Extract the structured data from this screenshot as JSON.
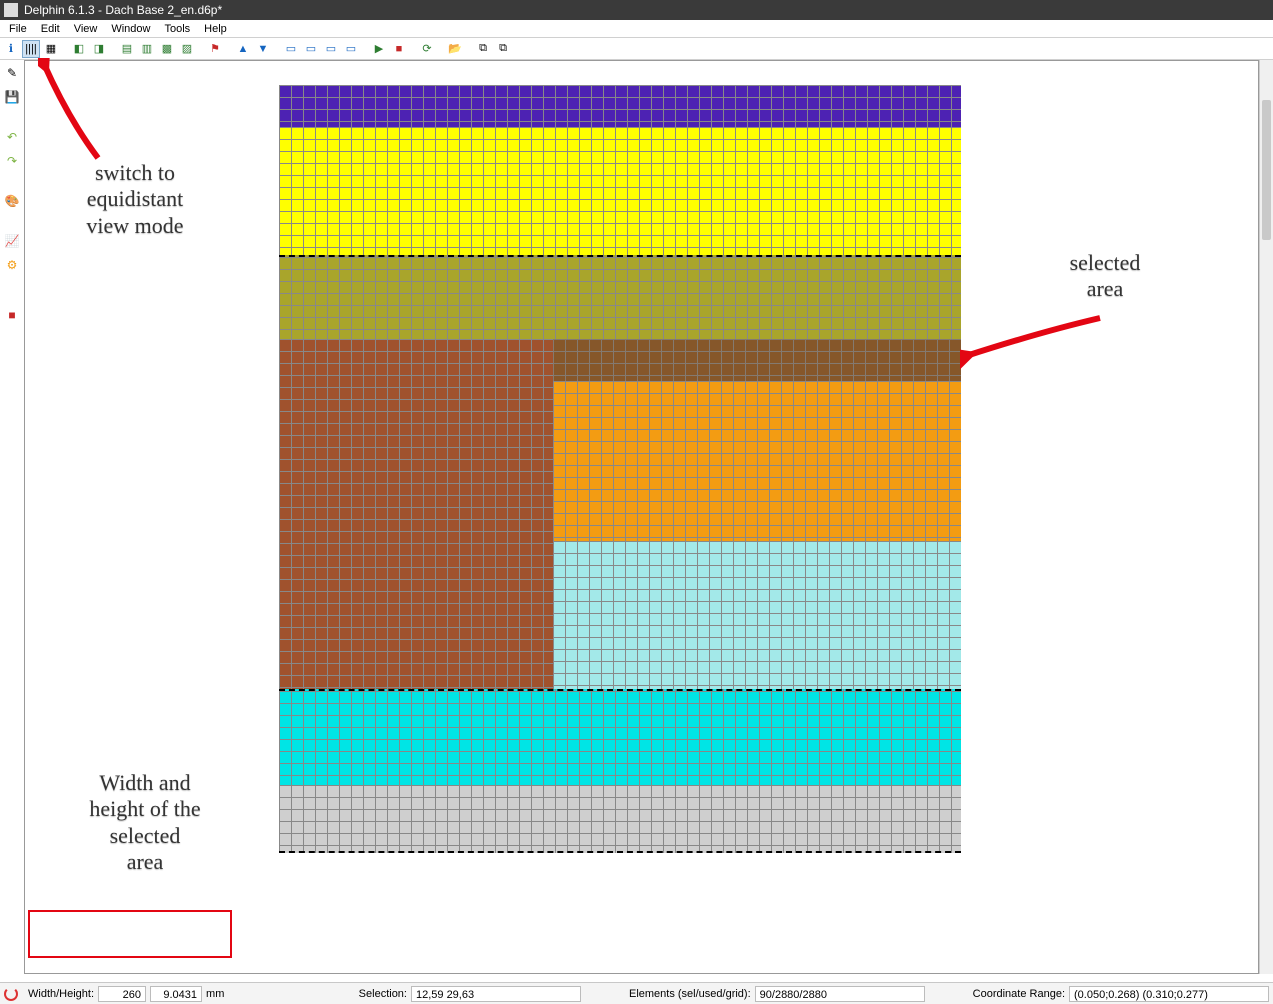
{
  "titlebar": {
    "text": "Delphin 6.1.3 - Dach Base 2_en.d6p*"
  },
  "menu": {
    "file": "File",
    "edit": "Edit",
    "view": "View",
    "window": "Window",
    "tools": "Tools",
    "help": "Help"
  },
  "toolbar": {
    "info": "ℹ",
    "grid": "▦",
    "equi": "||||",
    "proportional": "▦",
    "fliph": "⇋",
    "n1": "◧",
    "n2": "◨",
    "g1": "▤",
    "g2": "▥",
    "g3": "▩",
    "g4": "▨",
    "flag": "⚑",
    "flip": "▲",
    "flip2": "▼",
    "s1": "▭",
    "s2": "▭",
    "s3": "▭",
    "s4": "▭",
    "run": "▶",
    "stop": "■",
    "ref": "⟳",
    "open": "📂",
    "copy": "⧉",
    "paste": "⧉"
  },
  "vtool": {
    "new": "✎",
    "save": "💾",
    "undo": "↶",
    "redo": "↷",
    "paint": "🎨",
    "chart": "📈",
    "gear": "⚙",
    "color": "■"
  },
  "annotations": {
    "equidistant": "switch to\nequidistant\nview mode",
    "selected_area": "selected\narea",
    "width_height": "Width and\nheight of the\nselected\narea"
  },
  "status": {
    "wh_label": "Width/Height:",
    "width": "260",
    "height": "9.0431",
    "unit": "mm",
    "sel_label": "Selection:",
    "sel_value": "12,59 29,63",
    "elem_label": "Elements (sel/used/grid):",
    "elem_value": "90/2880/2880",
    "coord_label": "Coordinate Range:",
    "coord_value": "(0.050;0.268)  (0.310;0.277)"
  },
  "colors": {
    "purple": "#4d22b3",
    "yellow": "#ffff00",
    "olive": "#a9a52b",
    "orange": "#f39c12",
    "brown": "#a0522d",
    "darkbrown": "#8b5a2b",
    "ltblue": "#a3e9e9",
    "cyan": "#00e5e5",
    "grey": "#cfcfcf"
  }
}
